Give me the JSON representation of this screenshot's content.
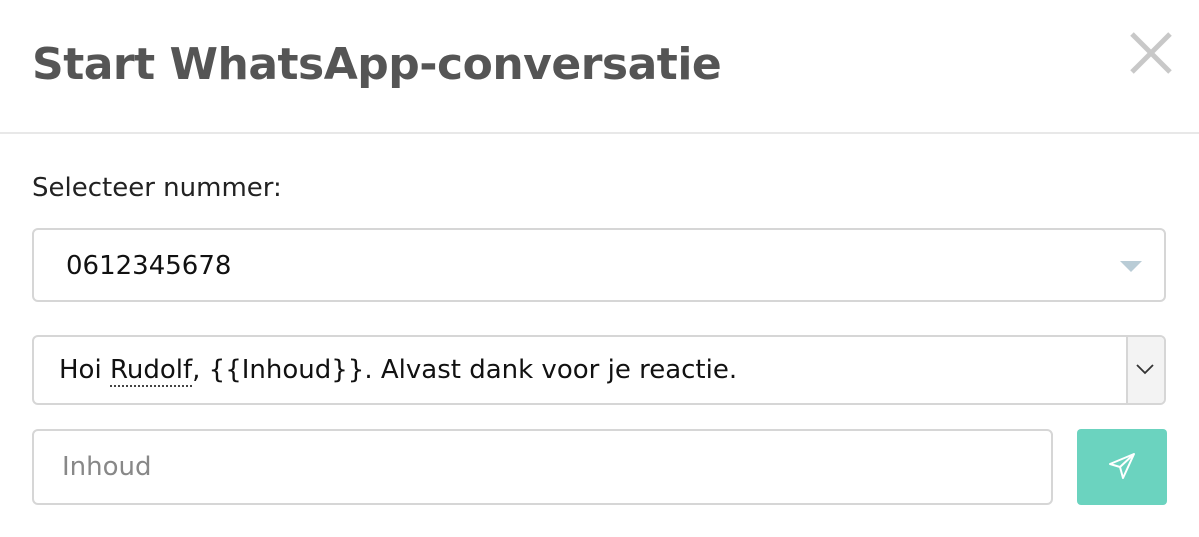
{
  "dialog": {
    "title": "Start WhatsApp-conversatie",
    "close_icon": "close-icon"
  },
  "number_select": {
    "label": "Selecteer nummer:",
    "selected_value": "0612345678",
    "caret_icon": "caret-down-icon",
    "caret_color": "#b9ccd6"
  },
  "template_select": {
    "prefix": "Hoi ",
    "name": "Rudolf",
    "suffix": ", {{Inhoud}}. Alvast dank voor je reactie.",
    "chevron_icon": "chevron-down-icon"
  },
  "content_input": {
    "value": "",
    "placeholder": "Inhoud"
  },
  "send_button": {
    "icon": "send-icon",
    "color": "#6bd3bf"
  }
}
